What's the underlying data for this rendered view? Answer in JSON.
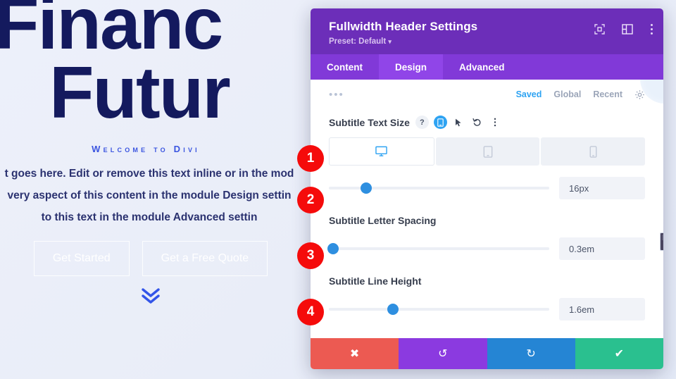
{
  "background_page": {
    "hero_title_line1": "Financ",
    "hero_title_line2": "Futur",
    "hero_subtitle": "Welcome to Divi",
    "hero_body_line1": "t goes here. Edit or remove this text inline or in the mod",
    "hero_body_line2": "very aspect of this content in the module Design settin",
    "hero_body_line3": "to this text in the module Advanced settin",
    "primary_button": "Get Started",
    "secondary_button": "Get a Free Quote",
    "scroll_icon": "double-chevron-down-icon",
    "title_color": "#141a5e",
    "subtitle_color": "#3b55e0"
  },
  "modal": {
    "title": "Fullwidth Header Settings",
    "preset_label": "Preset: Default",
    "preset_caret": "▾",
    "header_icons": [
      {
        "name": "focus-expand-icon"
      },
      {
        "name": "layout-panel-icon"
      },
      {
        "name": "more-options-icon"
      }
    ],
    "tabs": [
      {
        "label": "Content",
        "active": false
      },
      {
        "label": "Design",
        "active": true
      },
      {
        "label": "Advanced",
        "active": false
      }
    ],
    "toolbar": {
      "drag_handle": "•••",
      "links": [
        {
          "label": "Saved",
          "active": true
        },
        {
          "label": "Global",
          "active": false
        },
        {
          "label": "Recent",
          "active": false
        }
      ],
      "gear_icon": "gear-icon"
    },
    "header_bg": "#6c2eb9",
    "tab_bg": "#8139d8",
    "tab_active_bg": "#9045e8",
    "accent": "#2ea3f2"
  },
  "fields": [
    {
      "label": "Subtitle Text Size",
      "icons": [
        {
          "name": "help-icon",
          "glyph": "?",
          "active": false
        },
        {
          "name": "responsive-device-icon",
          "glyph": "▯",
          "active": true
        },
        {
          "name": "hover-cursor-icon",
          "glyph": "➤",
          "active": false
        },
        {
          "name": "reset-icon",
          "glyph": "↺",
          "active": false
        },
        {
          "name": "field-options-icon",
          "glyph": "⋮",
          "active": false
        }
      ],
      "devices": [
        {
          "name": "desktop-icon",
          "active": true
        },
        {
          "name": "tablet-icon",
          "active": false
        },
        {
          "name": "phone-icon",
          "active": false
        }
      ],
      "value": "16px",
      "slider_percent": 17
    },
    {
      "label": "Subtitle Letter Spacing",
      "value": "0.3em",
      "slider_percent": 2
    },
    {
      "label": "Subtitle Line Height",
      "value": "1.6em",
      "slider_percent": 29
    }
  ],
  "footer_buttons": [
    {
      "name": "cancel-button",
      "glyph": "✖",
      "color": "#ec5a52"
    },
    {
      "name": "undo-button",
      "glyph": "↺",
      "color": "#8b3ae0"
    },
    {
      "name": "redo-button",
      "glyph": "↻",
      "color": "#2585d4"
    },
    {
      "name": "save-button",
      "glyph": "✔",
      "color": "#2ac08f"
    }
  ],
  "annotations": {
    "badge_color": "#f50b0b",
    "steps": [
      "1",
      "2",
      "3",
      "4"
    ]
  }
}
